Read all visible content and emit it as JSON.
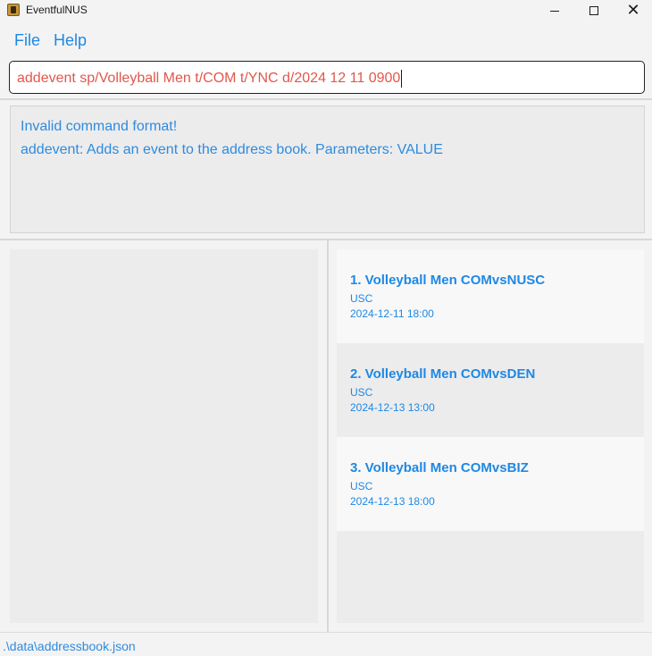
{
  "window": {
    "title": "EventfulNUS",
    "minimize_glyph": "",
    "maximize_glyph": "",
    "close_glyph": "✕"
  },
  "menu": {
    "file_label": "File",
    "help_label": "Help"
  },
  "command_box": {
    "value": "addevent sp/Volleyball Men t/COM t/YNC d/2024 12 11 0900"
  },
  "result_display": {
    "lines": [
      "Invalid command format!",
      "addevent: Adds an event to the address book. Parameters: VALUE"
    ]
  },
  "events": [
    {
      "title": "1. Volleyball Men COMvsNUSC",
      "venue": "USC",
      "datetime": "2024-12-11 18:00"
    },
    {
      "title": "2. Volleyball Men COMvsDEN",
      "venue": "USC",
      "datetime": "2024-12-13 13:00"
    },
    {
      "title": "3. Volleyball Men COMvsBIZ",
      "venue": "USC",
      "datetime": "2024-12-13 18:00"
    }
  ],
  "status_bar": {
    "file_path": ".\\data\\addressbook.json"
  },
  "colors": {
    "accent": "#1e88e5",
    "error_text": "#e2574c",
    "background": "#f3f3f3",
    "panel": "#ececec"
  }
}
